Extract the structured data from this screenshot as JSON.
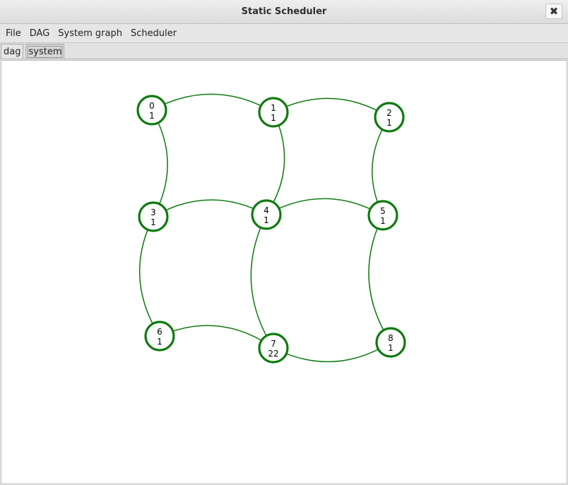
{
  "window": {
    "title": "Static Scheduler",
    "close_label": "✖"
  },
  "menu": {
    "items": [
      {
        "id": "file",
        "label": "File"
      },
      {
        "id": "dag",
        "label": "DAG"
      },
      {
        "id": "system-graph",
        "label": "System graph"
      },
      {
        "id": "scheduler",
        "label": "Scheduler"
      }
    ]
  },
  "tabs": [
    {
      "id": "dag",
      "label": "dag",
      "active": false
    },
    {
      "id": "system",
      "label": "system",
      "active": true
    }
  ],
  "graph": {
    "color": "#0f7a0f",
    "nodes": [
      {
        "id": "0",
        "weight": "1"
      },
      {
        "id": "1",
        "weight": "1"
      },
      {
        "id": "2",
        "weight": "1"
      },
      {
        "id": "3",
        "weight": "1"
      },
      {
        "id": "4",
        "weight": "1"
      },
      {
        "id": "5",
        "weight": "1"
      },
      {
        "id": "6",
        "weight": "1"
      },
      {
        "id": "7",
        "weight": "22"
      },
      {
        "id": "8",
        "weight": "1"
      }
    ],
    "edges": [
      [
        "0",
        "1"
      ],
      [
        "1",
        "2"
      ],
      [
        "0",
        "3"
      ],
      [
        "1",
        "4"
      ],
      [
        "2",
        "5"
      ],
      [
        "3",
        "4"
      ],
      [
        "4",
        "5"
      ],
      [
        "3",
        "6"
      ],
      [
        "4",
        "7"
      ],
      [
        "5",
        "8"
      ],
      [
        "6",
        "7"
      ],
      [
        "7",
        "8"
      ]
    ]
  }
}
